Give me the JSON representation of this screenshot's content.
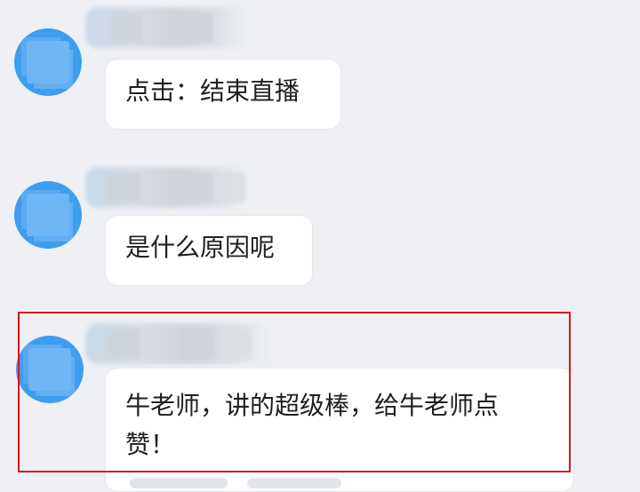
{
  "messages": [
    {
      "text": "点击：结束直播"
    },
    {
      "text": "是什么原因呢"
    },
    {
      "text": "牛老师，讲的超级棒，给牛老师点赞！"
    }
  ],
  "colors": {
    "background": "#eef0f4",
    "avatar": "#3d9df0",
    "bubble": "#ffffff",
    "highlight_border": "#e0101c"
  },
  "icons": [
    "user-avatar-icon"
  ]
}
